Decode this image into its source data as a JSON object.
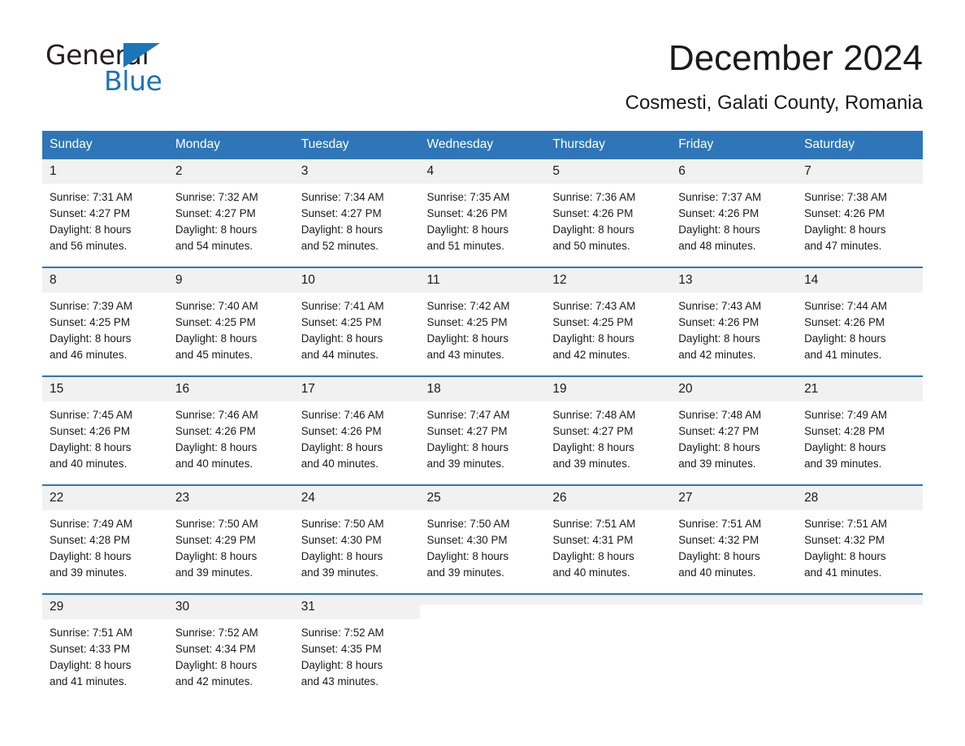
{
  "brand": {
    "name_part1": "General",
    "name_part2": "Blue",
    "accent_color": "#1b75bb"
  },
  "header": {
    "title": "December 2024",
    "subtitle": "Cosmesti, Galati County, Romania"
  },
  "calendar": {
    "header_color": "#2e76b8",
    "daynum_bg": "#f1f1f1",
    "weekdays": [
      "Sunday",
      "Monday",
      "Tuesday",
      "Wednesday",
      "Thursday",
      "Friday",
      "Saturday"
    ],
    "weeks": [
      [
        {
          "day": "1",
          "sunrise": "Sunrise: 7:31 AM",
          "sunset": "Sunset: 4:27 PM",
          "daylight_1": "Daylight: 8 hours",
          "daylight_2": "and 56 minutes."
        },
        {
          "day": "2",
          "sunrise": "Sunrise: 7:32 AM",
          "sunset": "Sunset: 4:27 PM",
          "daylight_1": "Daylight: 8 hours",
          "daylight_2": "and 54 minutes."
        },
        {
          "day": "3",
          "sunrise": "Sunrise: 7:34 AM",
          "sunset": "Sunset: 4:27 PM",
          "daylight_1": "Daylight: 8 hours",
          "daylight_2": "and 52 minutes."
        },
        {
          "day": "4",
          "sunrise": "Sunrise: 7:35 AM",
          "sunset": "Sunset: 4:26 PM",
          "daylight_1": "Daylight: 8 hours",
          "daylight_2": "and 51 minutes."
        },
        {
          "day": "5",
          "sunrise": "Sunrise: 7:36 AM",
          "sunset": "Sunset: 4:26 PM",
          "daylight_1": "Daylight: 8 hours",
          "daylight_2": "and 50 minutes."
        },
        {
          "day": "6",
          "sunrise": "Sunrise: 7:37 AM",
          "sunset": "Sunset: 4:26 PM",
          "daylight_1": "Daylight: 8 hours",
          "daylight_2": "and 48 minutes."
        },
        {
          "day": "7",
          "sunrise": "Sunrise: 7:38 AM",
          "sunset": "Sunset: 4:26 PM",
          "daylight_1": "Daylight: 8 hours",
          "daylight_2": "and 47 minutes."
        }
      ],
      [
        {
          "day": "8",
          "sunrise": "Sunrise: 7:39 AM",
          "sunset": "Sunset: 4:25 PM",
          "daylight_1": "Daylight: 8 hours",
          "daylight_2": "and 46 minutes."
        },
        {
          "day": "9",
          "sunrise": "Sunrise: 7:40 AM",
          "sunset": "Sunset: 4:25 PM",
          "daylight_1": "Daylight: 8 hours",
          "daylight_2": "and 45 minutes."
        },
        {
          "day": "10",
          "sunrise": "Sunrise: 7:41 AM",
          "sunset": "Sunset: 4:25 PM",
          "daylight_1": "Daylight: 8 hours",
          "daylight_2": "and 44 minutes."
        },
        {
          "day": "11",
          "sunrise": "Sunrise: 7:42 AM",
          "sunset": "Sunset: 4:25 PM",
          "daylight_1": "Daylight: 8 hours",
          "daylight_2": "and 43 minutes."
        },
        {
          "day": "12",
          "sunrise": "Sunrise: 7:43 AM",
          "sunset": "Sunset: 4:25 PM",
          "daylight_1": "Daylight: 8 hours",
          "daylight_2": "and 42 minutes."
        },
        {
          "day": "13",
          "sunrise": "Sunrise: 7:43 AM",
          "sunset": "Sunset: 4:26 PM",
          "daylight_1": "Daylight: 8 hours",
          "daylight_2": "and 42 minutes."
        },
        {
          "day": "14",
          "sunrise": "Sunrise: 7:44 AM",
          "sunset": "Sunset: 4:26 PM",
          "daylight_1": "Daylight: 8 hours",
          "daylight_2": "and 41 minutes."
        }
      ],
      [
        {
          "day": "15",
          "sunrise": "Sunrise: 7:45 AM",
          "sunset": "Sunset: 4:26 PM",
          "daylight_1": "Daylight: 8 hours",
          "daylight_2": "and 40 minutes."
        },
        {
          "day": "16",
          "sunrise": "Sunrise: 7:46 AM",
          "sunset": "Sunset: 4:26 PM",
          "daylight_1": "Daylight: 8 hours",
          "daylight_2": "and 40 minutes."
        },
        {
          "day": "17",
          "sunrise": "Sunrise: 7:46 AM",
          "sunset": "Sunset: 4:26 PM",
          "daylight_1": "Daylight: 8 hours",
          "daylight_2": "and 40 minutes."
        },
        {
          "day": "18",
          "sunrise": "Sunrise: 7:47 AM",
          "sunset": "Sunset: 4:27 PM",
          "daylight_1": "Daylight: 8 hours",
          "daylight_2": "and 39 minutes."
        },
        {
          "day": "19",
          "sunrise": "Sunrise: 7:48 AM",
          "sunset": "Sunset: 4:27 PM",
          "daylight_1": "Daylight: 8 hours",
          "daylight_2": "and 39 minutes."
        },
        {
          "day": "20",
          "sunrise": "Sunrise: 7:48 AM",
          "sunset": "Sunset: 4:27 PM",
          "daylight_1": "Daylight: 8 hours",
          "daylight_2": "and 39 minutes."
        },
        {
          "day": "21",
          "sunrise": "Sunrise: 7:49 AM",
          "sunset": "Sunset: 4:28 PM",
          "daylight_1": "Daylight: 8 hours",
          "daylight_2": "and 39 minutes."
        }
      ],
      [
        {
          "day": "22",
          "sunrise": "Sunrise: 7:49 AM",
          "sunset": "Sunset: 4:28 PM",
          "daylight_1": "Daylight: 8 hours",
          "daylight_2": "and 39 minutes."
        },
        {
          "day": "23",
          "sunrise": "Sunrise: 7:50 AM",
          "sunset": "Sunset: 4:29 PM",
          "daylight_1": "Daylight: 8 hours",
          "daylight_2": "and 39 minutes."
        },
        {
          "day": "24",
          "sunrise": "Sunrise: 7:50 AM",
          "sunset": "Sunset: 4:30 PM",
          "daylight_1": "Daylight: 8 hours",
          "daylight_2": "and 39 minutes."
        },
        {
          "day": "25",
          "sunrise": "Sunrise: 7:50 AM",
          "sunset": "Sunset: 4:30 PM",
          "daylight_1": "Daylight: 8 hours",
          "daylight_2": "and 39 minutes."
        },
        {
          "day": "26",
          "sunrise": "Sunrise: 7:51 AM",
          "sunset": "Sunset: 4:31 PM",
          "daylight_1": "Daylight: 8 hours",
          "daylight_2": "and 40 minutes."
        },
        {
          "day": "27",
          "sunrise": "Sunrise: 7:51 AM",
          "sunset": "Sunset: 4:32 PM",
          "daylight_1": "Daylight: 8 hours",
          "daylight_2": "and 40 minutes."
        },
        {
          "day": "28",
          "sunrise": "Sunrise: 7:51 AM",
          "sunset": "Sunset: 4:32 PM",
          "daylight_1": "Daylight: 8 hours",
          "daylight_2": "and 41 minutes."
        }
      ],
      [
        {
          "day": "29",
          "sunrise": "Sunrise: 7:51 AM",
          "sunset": "Sunset: 4:33 PM",
          "daylight_1": "Daylight: 8 hours",
          "daylight_2": "and 41 minutes."
        },
        {
          "day": "30",
          "sunrise": "Sunrise: 7:52 AM",
          "sunset": "Sunset: 4:34 PM",
          "daylight_1": "Daylight: 8 hours",
          "daylight_2": "and 42 minutes."
        },
        {
          "day": "31",
          "sunrise": "Sunrise: 7:52 AM",
          "sunset": "Sunset: 4:35 PM",
          "daylight_1": "Daylight: 8 hours",
          "daylight_2": "and 43 minutes."
        },
        {
          "day": "",
          "sunrise": "",
          "sunset": "",
          "daylight_1": "",
          "daylight_2": ""
        },
        {
          "day": "",
          "sunrise": "",
          "sunset": "",
          "daylight_1": "",
          "daylight_2": ""
        },
        {
          "day": "",
          "sunrise": "",
          "sunset": "",
          "daylight_1": "",
          "daylight_2": ""
        },
        {
          "day": "",
          "sunrise": "",
          "sunset": "",
          "daylight_1": "",
          "daylight_2": ""
        }
      ]
    ]
  }
}
